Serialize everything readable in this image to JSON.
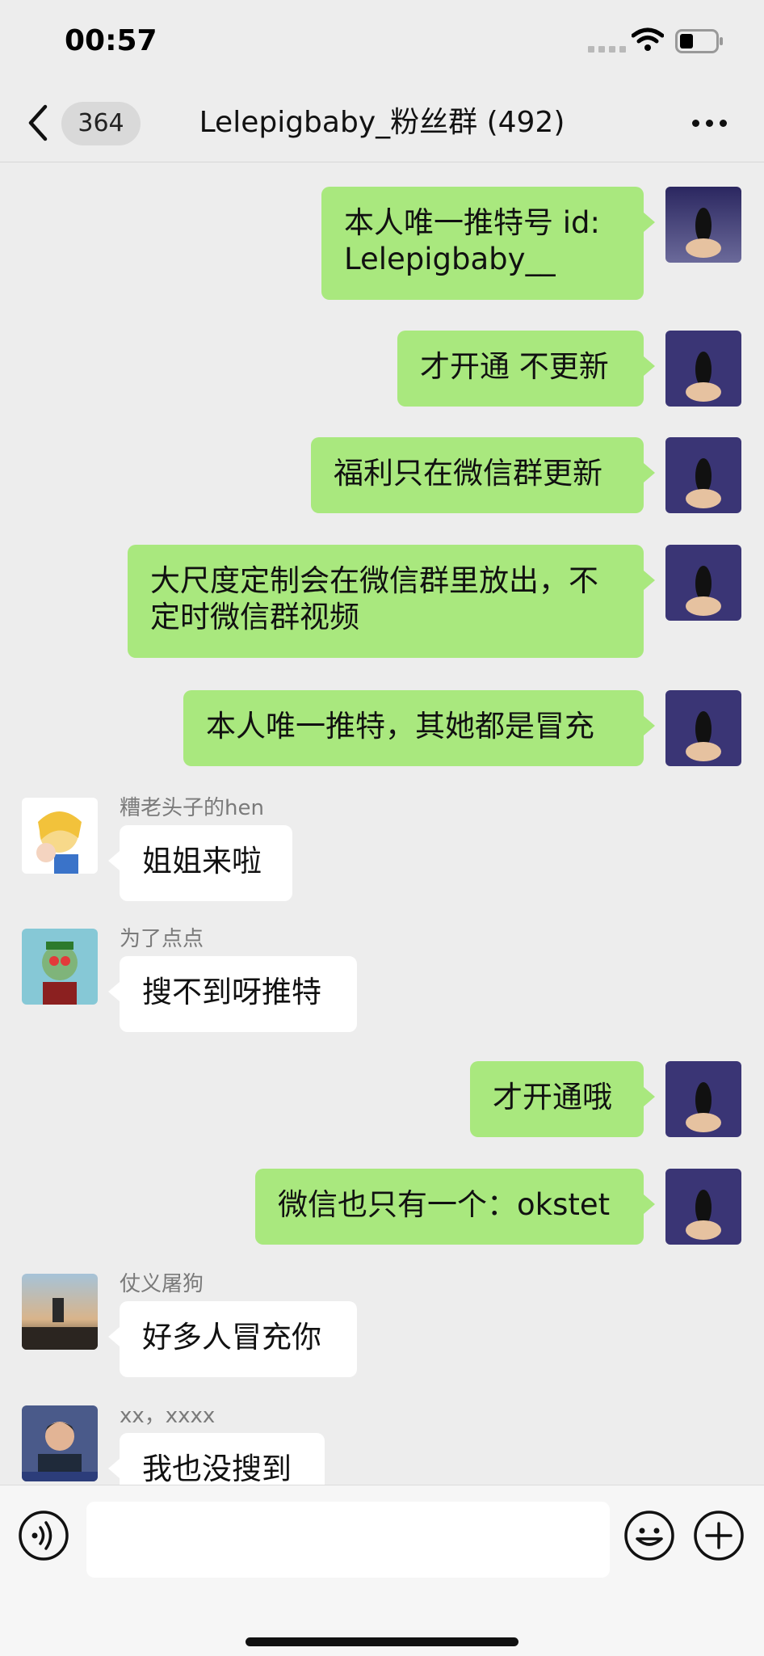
{
  "status_bar": {
    "time": "00:57"
  },
  "nav": {
    "back_icon": "chevron-left-icon",
    "unread_count": "364",
    "title": "Lelepigbaby_粉丝群 (492)",
    "more_icon": "more-icon"
  },
  "messages": [
    {
      "side": "right",
      "text": "本人唯一推特号 id:\nLelepigbaby__"
    },
    {
      "side": "right",
      "text": "才开通 不更新"
    },
    {
      "side": "right",
      "text": "福利只在微信群更新"
    },
    {
      "side": "right",
      "text": "大尺度定制会在微信群里放出，不\n定时微信群视频"
    },
    {
      "side": "right",
      "text": "本人唯一推特，其她都是冒充"
    },
    {
      "side": "left",
      "sender": "糟老头子的hen",
      "text": "姐姐来啦"
    },
    {
      "side": "left",
      "sender": "为了点点",
      "text": "搜不到呀推特"
    },
    {
      "side": "right",
      "text": "才开通哦"
    },
    {
      "side": "right",
      "text": "微信也只有一个：okstet"
    },
    {
      "side": "left",
      "sender": "仗义屠狗",
      "text": "好多人冒充你"
    },
    {
      "side": "left",
      "sender": "xx，xxxx",
      "text": "我也没搜到"
    }
  ],
  "input_bar": {
    "voice_icon": "voice-icon",
    "emoji_icon": "emoji-icon",
    "plus_icon": "plus-icon",
    "input_value": ""
  },
  "colors": {
    "background": "#ededed",
    "my_bubble": "#a9e87e",
    "other_bubble": "#ffffff"
  }
}
